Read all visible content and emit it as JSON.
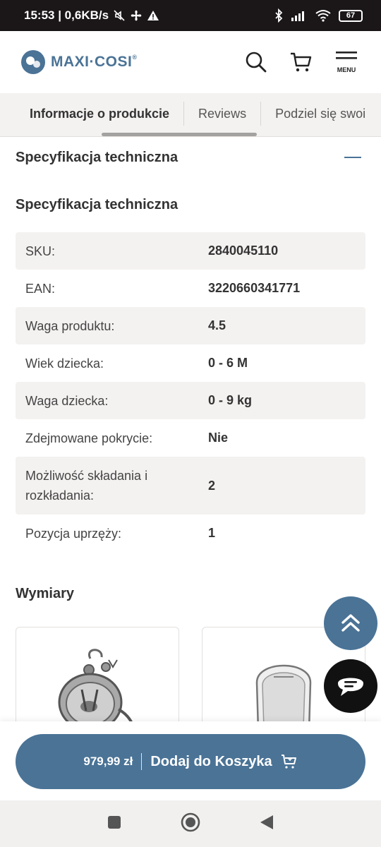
{
  "status_bar": {
    "time_speed": "15:53 | 0,6KB/s",
    "battery": "67"
  },
  "header": {
    "logo_text": "MAXI·COSI",
    "logo_reg": "®",
    "menu_label": "MENU"
  },
  "tabs": [
    {
      "label": "Informacje o produkcie",
      "active": true
    },
    {
      "label": "Reviews",
      "active": false
    },
    {
      "label": "Podziel się swoi",
      "active": false
    }
  ],
  "accordion": {
    "title": "Specyfikacja techniczna"
  },
  "specs": {
    "title": "Specyfikacja techniczna",
    "rows": [
      {
        "label": "SKU:",
        "value": "2840045110"
      },
      {
        "label": "EAN:",
        "value": "3220660341771"
      },
      {
        "label": "Waga produktu:",
        "value": "4.5"
      },
      {
        "label": "Wiek dziecka:",
        "value": "0 - 6 M"
      },
      {
        "label": "Waga dziecka:",
        "value": "0 - 9 kg"
      },
      {
        "label": "Zdejmowane pokrycie:",
        "value": "Nie"
      },
      {
        "label": "Możliwość składania i rozkładania:",
        "value": "2"
      },
      {
        "label": "Pozycja uprzęży:",
        "value": "1"
      }
    ]
  },
  "dimensions": {
    "title": "Wymiary"
  },
  "cart": {
    "price": "979,99 zł",
    "label": "Dodaj do Koszyka"
  },
  "colors": {
    "brand": "#4a7396",
    "dark": "#111111",
    "shaded_row": "#f4f2f1"
  },
  "icons": [
    "search-icon",
    "cart-icon",
    "menu-icon",
    "chevron-up-icon",
    "chat-icon",
    "accessibility-icon",
    "home-icon",
    "back-icon",
    "recents-icon"
  ]
}
